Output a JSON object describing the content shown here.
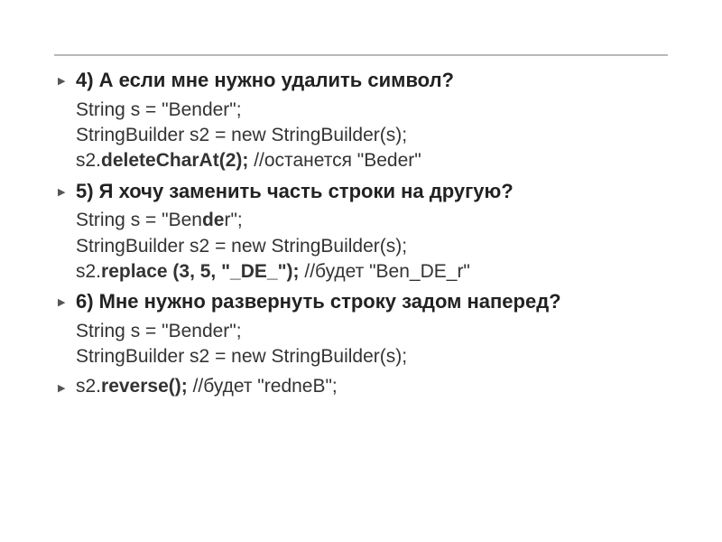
{
  "q4": {
    "title": "4) А если мне нужно удалить символ?",
    "line1_pre": "String s = \"Bender\";",
    "line2": "StringBuilder s2 = new StringBuilder(s);",
    "line3_a": "s2.",
    "line3_b": "deleteCharAt(2);",
    "line3_c": " //останется \"Beder\""
  },
  "q5": {
    "title": "5) Я хочу заменить часть строки на другую?",
    "line1_a": "String s = \"Ben",
    "line1_b": "de",
    "line1_c": "r\";",
    "line2": "StringBuilder s2 = new StringBuilder(s);",
    "line3_a": "s2.",
    "line3_b": "replace (3, 5, \"_DE_\");",
    "line3_c": " //будет \"Ben_DE_r\""
  },
  "q6": {
    "title": "6) Мне нужно развернуть строку задом наперед?",
    "line1": "String s = \"Bender\";",
    "line2": "StringBuilder s2 = new StringBuilder(s);",
    "line3_a": "s2.",
    "line3_b": "reverse();",
    "line3_c": " //будет \"redneB\";"
  }
}
